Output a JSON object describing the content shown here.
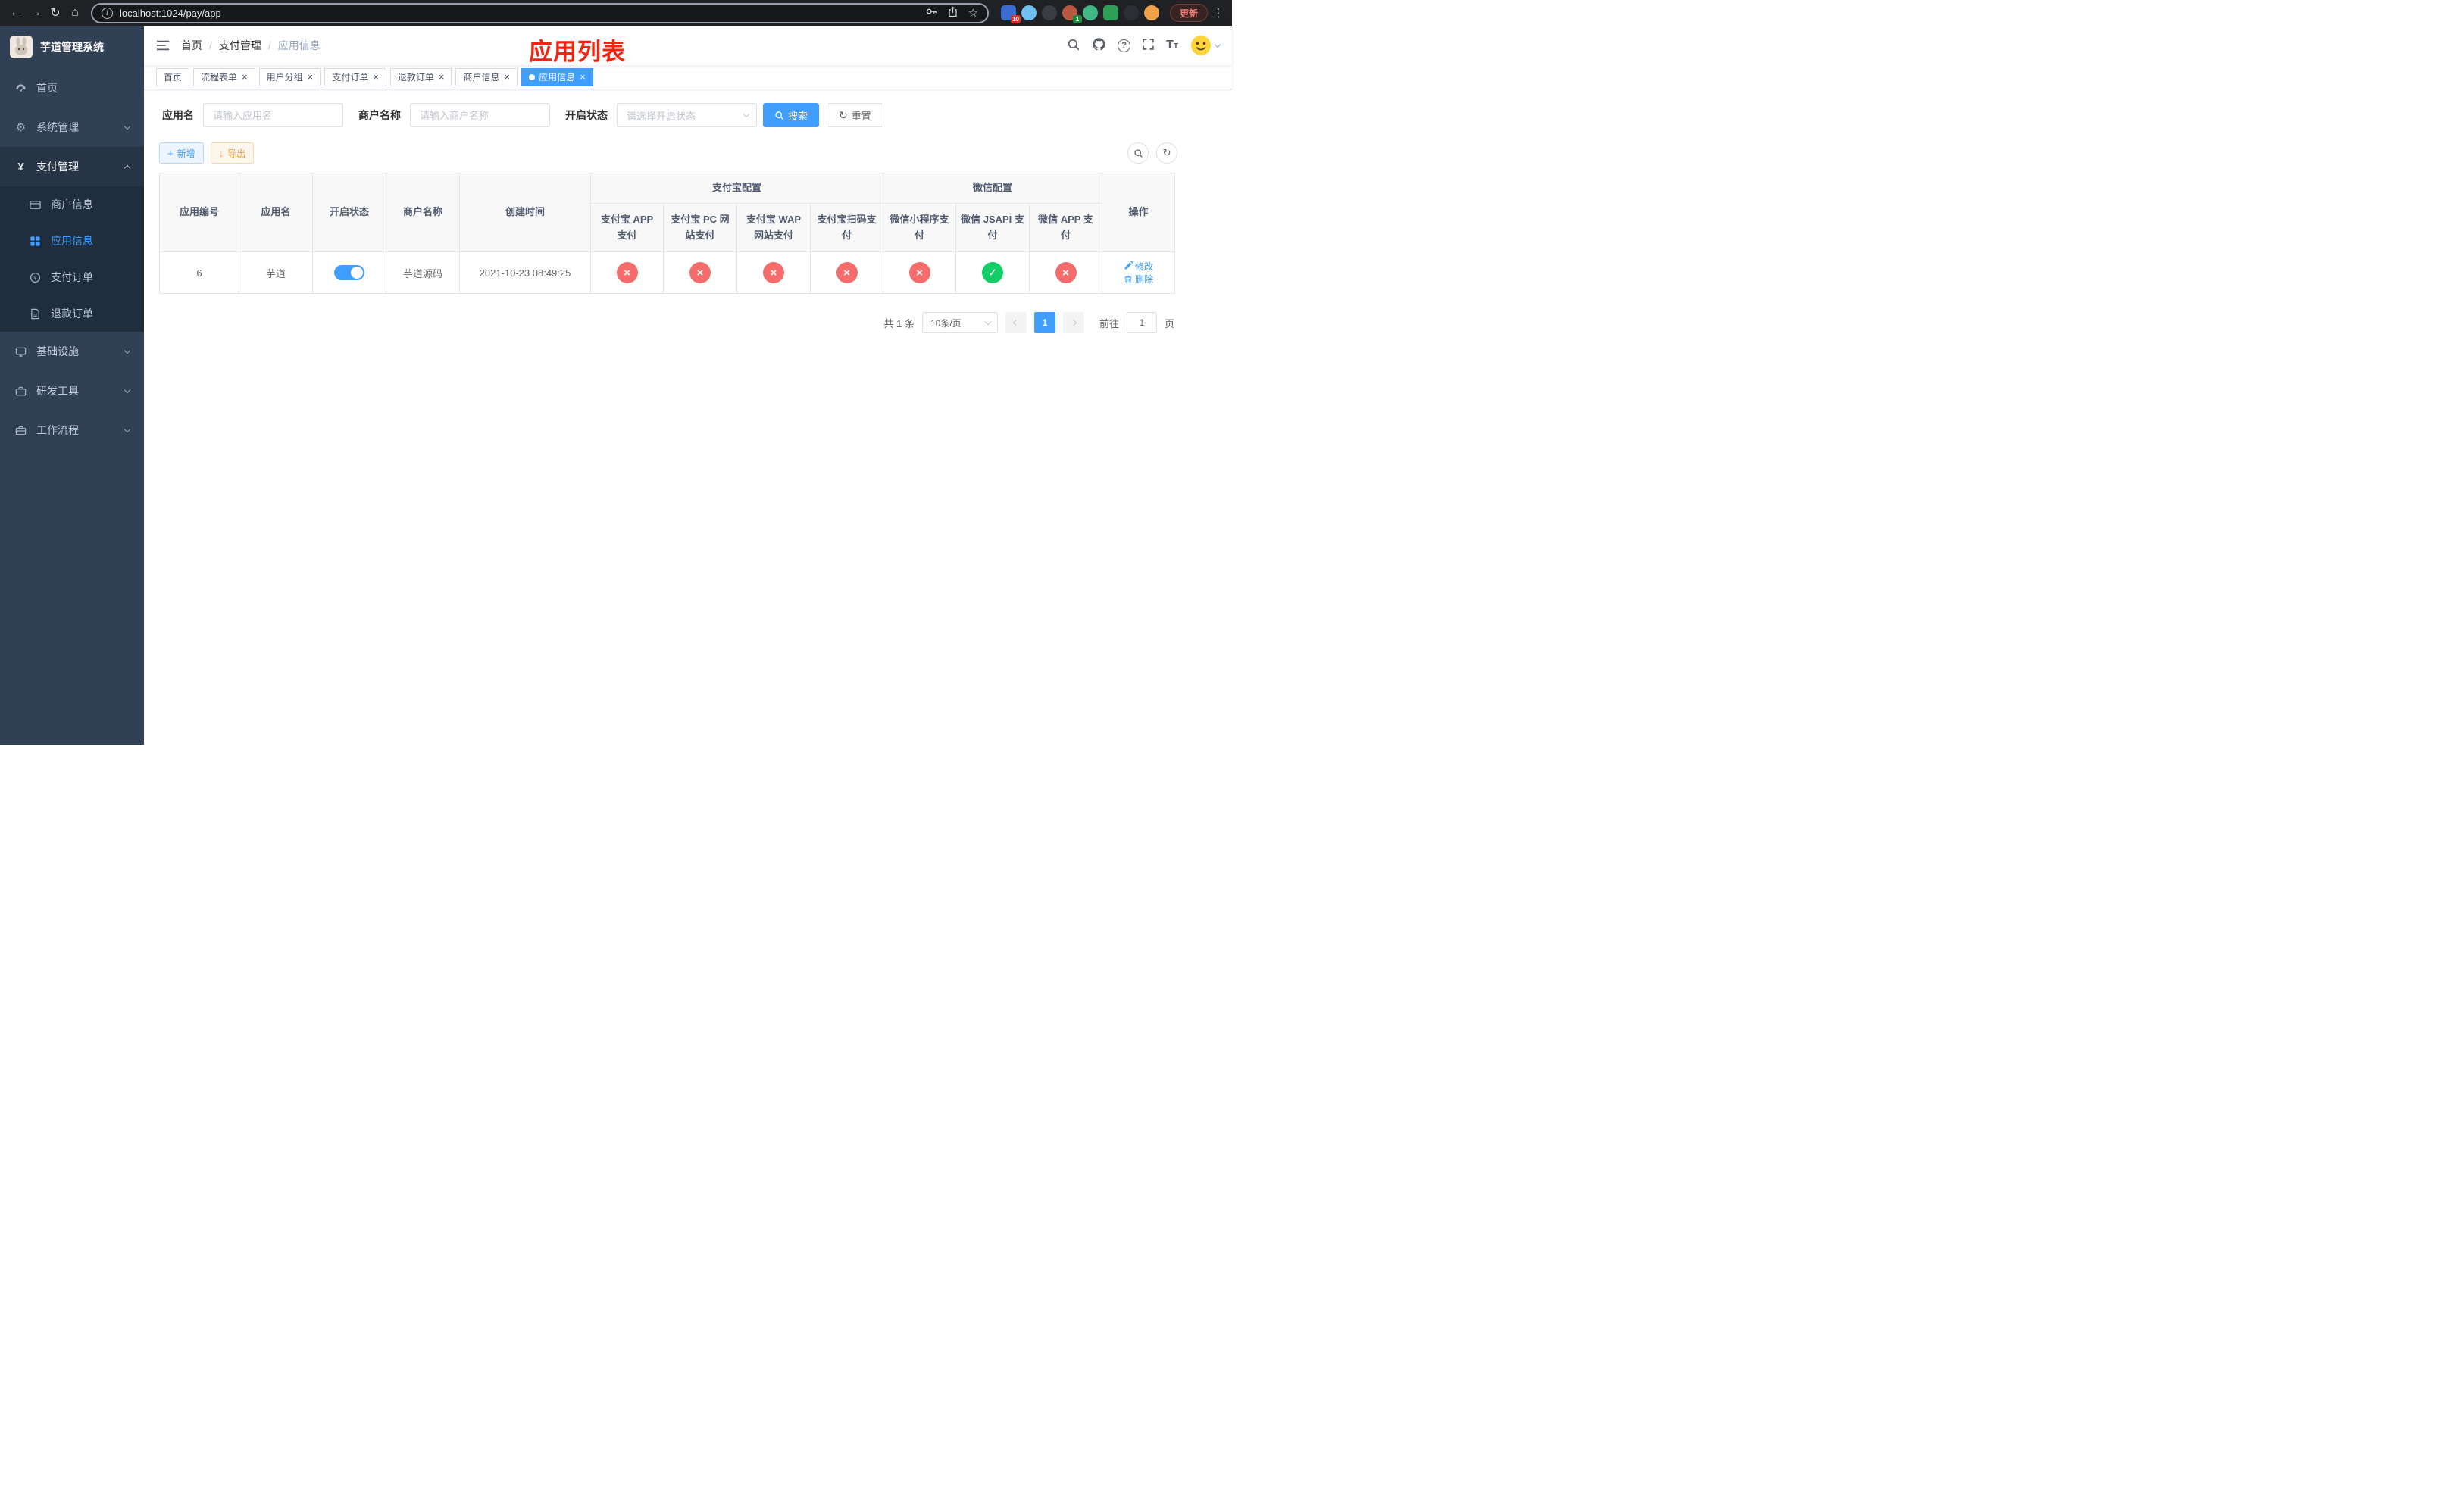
{
  "browser": {
    "url": "localhost:1024/pay/app",
    "update_label": "更新",
    "extension_badge_1": "10",
    "extension_badge_2": "1"
  },
  "sidebar": {
    "title": "芋道管理系统",
    "home": "首页",
    "system": "系统管理",
    "pay": "支付管理",
    "pay_children": {
      "merchant": "商户信息",
      "app": "应用信息",
      "order": "支付订单",
      "refund": "退款订单"
    },
    "infra": "基础设施",
    "devtools": "研发工具",
    "workflow": "工作流程"
  },
  "header": {
    "breadcrumb": {
      "home": "首页",
      "pay": "支付管理",
      "current": "应用信息"
    },
    "annotation": "应用列表"
  },
  "tabs": {
    "t0": "首页",
    "t1": "流程表单",
    "t2": "用户分组",
    "t3": "支付订单",
    "t4": "退款订单",
    "t5": "商户信息",
    "t6": "应用信息"
  },
  "filters": {
    "app_name_label": "应用名",
    "app_name_placeholder": "请输入应用名",
    "merchant_label": "商户名称",
    "merchant_placeholder": "请输入商户名称",
    "status_label": "开启状态",
    "status_placeholder": "请选择开启状态",
    "search": "搜索",
    "reset": "重置"
  },
  "toolbar": {
    "add": "新增",
    "export": "导出"
  },
  "table": {
    "col_id": "应用编号",
    "col_name": "应用名",
    "col_status": "开启状态",
    "col_merchant": "商户名称",
    "col_created": "创建时间",
    "group_alipay": "支付宝配置",
    "group_wechat": "微信配置",
    "col_alipay_app": "支付宝 APP 支付",
    "col_alipay_pc": "支付宝 PC 网站支付",
    "col_alipay_wap": "支付宝 WAP 网站支付",
    "col_alipay_qr": "支付宝扫码支付",
    "col_wx_mini": "微信小程序支付",
    "col_wx_jsapi": "微信 JSAPI 支付",
    "col_wx_app": "微信 APP 支付",
    "col_actions": "操作",
    "rows": [
      {
        "id": "6",
        "name": "芋道",
        "enabled": true,
        "merchant": "芋道源码",
        "created": "2021-10-23 08:49:25",
        "alipay_app": "fail",
        "alipay_pc": "fail",
        "alipay_wap": "fail",
        "alipay_qr": "fail",
        "wx_mini": "fail",
        "wx_jsapi": "success",
        "wx_app": "fail",
        "edit": "修改",
        "delete": "删除"
      }
    ]
  },
  "pagination": {
    "total": "共 1 条",
    "page_size": "10条/页",
    "page": "1",
    "goto": "前往",
    "goto_value": "1",
    "unit": "页"
  },
  "colors": {
    "primary": "#409eff",
    "danger": "#f56c6c",
    "success": "#13ce66",
    "warning": "#e6a23c",
    "sidebar_bg": "#304156",
    "annotation_red": "#f4230f"
  }
}
